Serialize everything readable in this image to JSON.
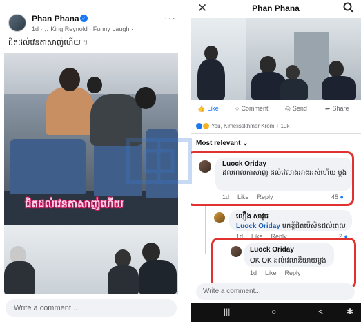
{
  "left": {
    "page_name": "Phan Phana",
    "meta": "1d · ♫ King Reynold · Funny Laugh · ",
    "more": "···",
    "caption": "ជិតដល់វេនតាសាញ់ហើយ ។",
    "subtitle": "ជិតដល់វេនតាសាញ់ហើយ",
    "comment_placeholder": "Write a comment..."
  },
  "right": {
    "title": "Phan Phana",
    "actions": {
      "like": "Like",
      "comment": "Comment",
      "send": "Send",
      "share": "Share"
    },
    "reactions_text": "You, Klmelisskhmer Krom + 10k",
    "sort_label": "Most relevant",
    "comments": [
      {
        "name": "Luock Oriday",
        "text": "ដល់ពេលតាសាញ់ ដល់វេលាងអាងអស់ហើយ ម្តង",
        "time": "1d",
        "like": "Like",
        "reply": "Reply",
        "likes": "45"
      },
      {
        "name": "លឿង សាវុធ",
        "mention": "Luock Oriday",
        "text": "មកខ្ចីជិតបើសិនដល់ពេល",
        "time": "1d",
        "like": "Like",
        "reply": "Reply",
        "likes": "2"
      },
      {
        "name": "Luock Oriday",
        "text": "OK OK ដល់វេលានិយាយម្ចង",
        "time": "1d",
        "like": "Like",
        "reply": "Reply"
      }
    ],
    "write_placeholder": "Write a comment...",
    "nav": [
      "|||",
      "○",
      "<",
      "✱"
    ]
  },
  "colors": {
    "accent": "#1877f2",
    "highlight": "#e0322e"
  }
}
